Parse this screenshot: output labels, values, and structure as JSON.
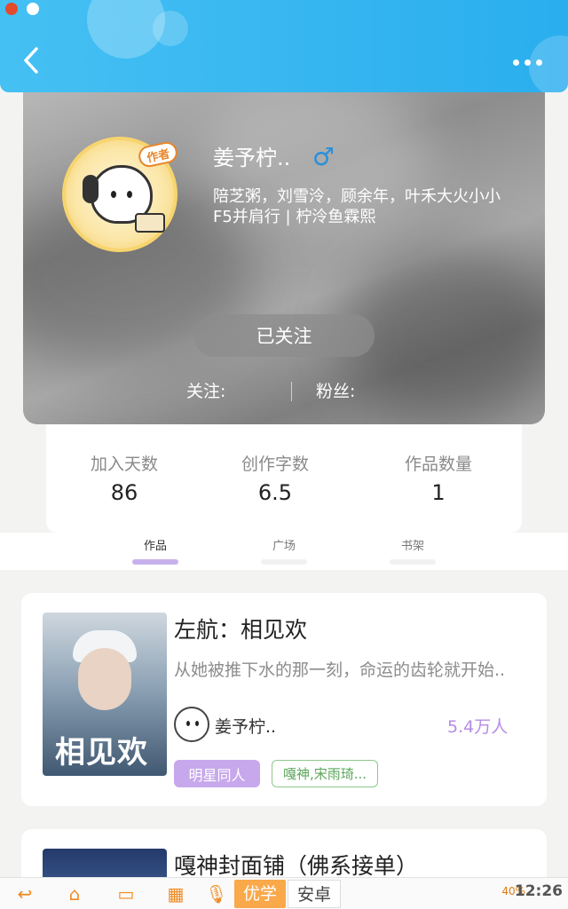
{
  "header": {
    "back_icon": "chevron-left-icon",
    "more_icon": "more-dots-icon"
  },
  "profile": {
    "badge": "作者",
    "name": "姜予柠..",
    "gender_symbol": "♂",
    "bio": "陪芝粥，刘雪泠，顾余年，叶禾大火小小F5并肩行 | 柠泠鱼霖熙",
    "follow_button": "已关注",
    "following_label": "关注:",
    "fans_label": "粉丝:"
  },
  "stats": [
    {
      "label": "加入天数",
      "value": "86"
    },
    {
      "label": "创作字数",
      "value": "6.5"
    },
    {
      "label": "作品数量",
      "value": "1"
    }
  ],
  "tabs": [
    {
      "label": "作品",
      "active": true
    },
    {
      "label": "广场",
      "active": false
    },
    {
      "label": "书架",
      "active": false
    }
  ],
  "works": [
    {
      "title": "左航：相见欢",
      "cover_text": "相见欢",
      "description": "从她被推下水的那一刻，命运的齿轮就开始..",
      "author": "姜予柠..",
      "readers": "5.4万人",
      "tag_primary": "明星同人",
      "tag_secondary": "嘎神,宋雨琦..."
    },
    {
      "title": "嘎神封面铺（佛系接单）"
    }
  ],
  "system_bar": {
    "tab_active": "优学",
    "tab_other": "安卓",
    "status": "40%",
    "time": "12:26"
  },
  "colors": {
    "header_blue": "#2aaeee",
    "accent_purple": "#c7a8ec",
    "reader_purple": "#b48ce6",
    "gender_blue": "#2a90d8"
  }
}
